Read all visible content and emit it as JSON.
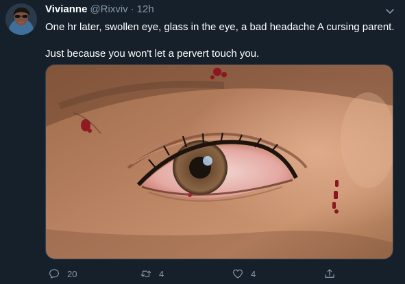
{
  "tweet": {
    "display_name": "Vivianne",
    "handle": "@Rixviv",
    "separator": "·",
    "timestamp": "12h",
    "text_line_1": "One hr later, swollen eye, glass in the eye, a bad headache A cursing parent.",
    "text_line_2": "Just because you won't let a pervert touch you."
  },
  "actions": {
    "reply_count": "20",
    "retweet_count": "4",
    "like_count": "4"
  },
  "icons": {
    "reply": "comment-bubble-icon",
    "retweet": "retweet-arrows-icon",
    "like": "heart-outline-icon",
    "share": "share-upload-icon",
    "menu": "chevron-down-icon"
  },
  "colors": {
    "background": "#15202b",
    "secondary_text": "#8899a6",
    "border": "#38444d"
  }
}
